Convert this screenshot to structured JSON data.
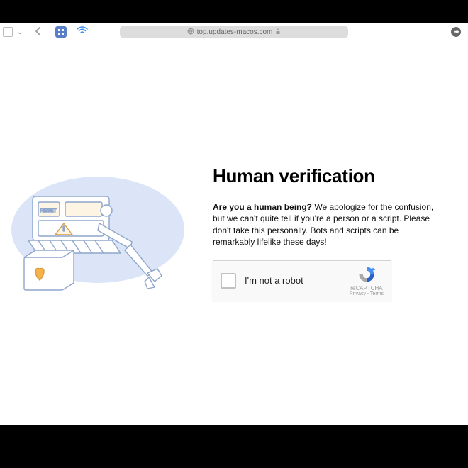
{
  "browser": {
    "url": "top.updates-macos.com"
  },
  "page": {
    "heading": "Human verification",
    "lead_bold": "Are you a human being?",
    "lead_rest": " We apologize for the confusion, but we can't quite tell if you're a person or a script. Please don't take this personally. Bots and scripts can be remarkably lifelike these days!"
  },
  "captcha": {
    "label": "I'm not a robot",
    "brand": "reCAPTCHA",
    "legal": "Privacy - Terms"
  }
}
